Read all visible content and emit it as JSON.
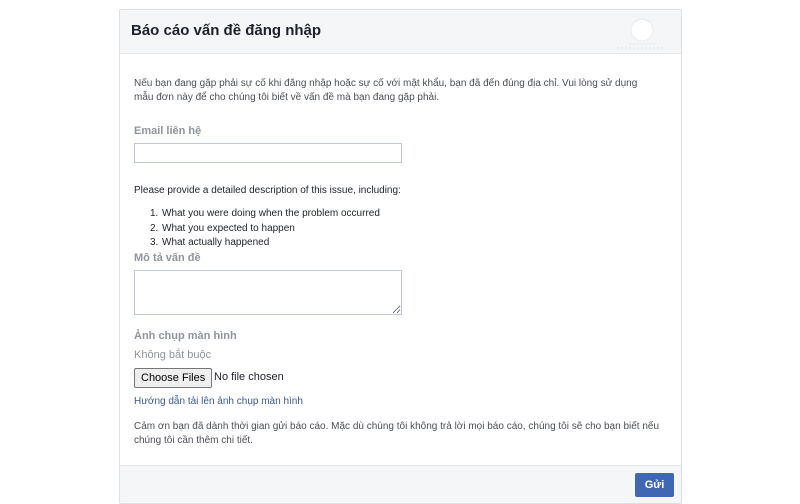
{
  "header": {
    "title": "Báo cáo vấn đề đăng nhập",
    "accent_color": "#4267b2"
  },
  "intro": "Nếu bạn đang gặp phải sự cố khi đăng nhập hoặc sự cố với mật khẩu, bạn đã đến đúng địa chỉ. Vui lòng sử dụng mẫu đơn này để cho chúng tôi biết về vấn đề mà bạn đang gặp phải.",
  "email": {
    "label": "Email liên hệ",
    "value": "",
    "placeholder": ""
  },
  "description": {
    "prompt": "Please provide a detailed description of this issue, including:",
    "items": [
      {
        "num": "1.",
        "text": "What you were doing when the problem occurred"
      },
      {
        "num": "2.",
        "text": "What you expected to happen"
      },
      {
        "num": "3.",
        "text": "What actually happened"
      }
    ],
    "label": "Mô tả vấn đề",
    "value": ""
  },
  "screenshot": {
    "label": "Ảnh chụp màn hình",
    "optional": "Không bắt buộc",
    "choose_label": "Choose Files",
    "no_file_text": "No file chosen",
    "guide_link": "Hướng dẫn tải lên ảnh chụp màn hình"
  },
  "thanks": "Cảm ơn bạn đã dành thời gian gửi báo cáo. Mặc dù chúng tôi không trả lời mọi báo cáo, chúng tôi sẽ cho bạn biết nếu chúng tôi cần thêm chi tiết.",
  "footer": {
    "submit_label": "Gửi"
  }
}
